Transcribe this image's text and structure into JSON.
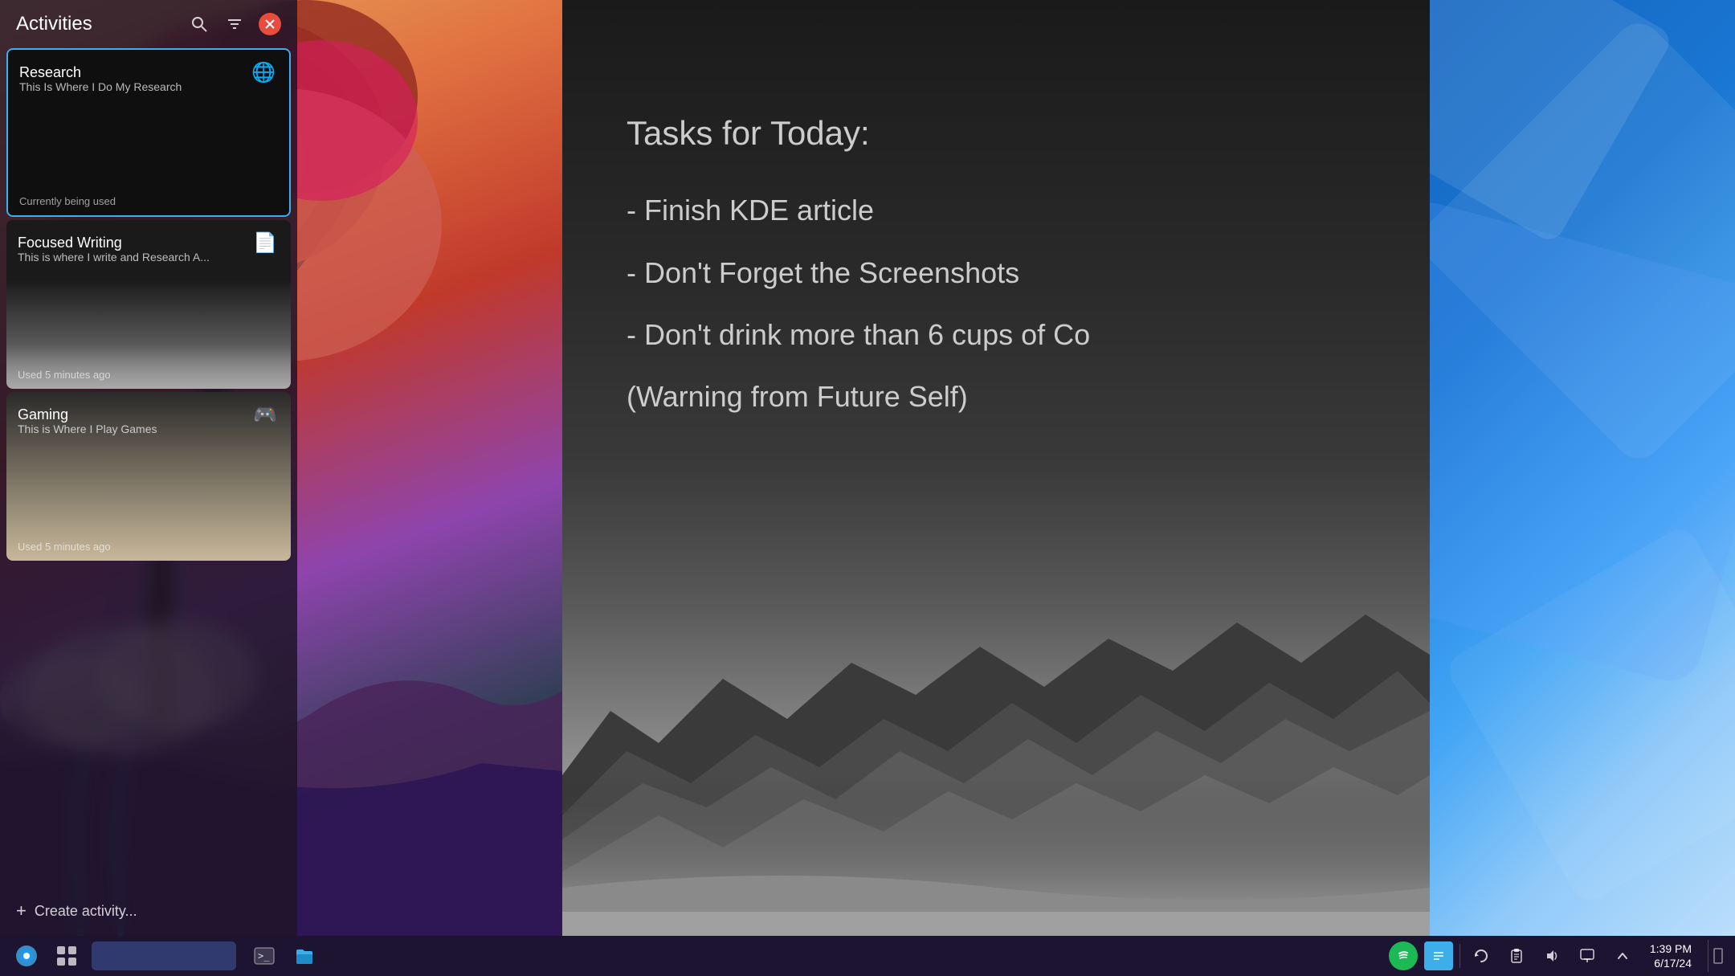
{
  "activities_panel": {
    "title": "Activities",
    "activities": [
      {
        "id": "research",
        "name": "Research",
        "description": "This Is Where I Do My Research",
        "status": "Currently being used",
        "icon": "🌐",
        "active": true
      },
      {
        "id": "focused-writing",
        "name": "Focused Writing",
        "description": "This is where I write and Research A...",
        "status": "Used 5 minutes ago",
        "icon": "📄",
        "active": false
      },
      {
        "id": "gaming",
        "name": "Gaming",
        "description": "This is Where I Play Games",
        "status": "Used 5 minutes ago",
        "icon": "🎮",
        "active": false
      }
    ],
    "create_label": "Create activity..."
  },
  "main_content": {
    "tasks_title": "Tasks for Today:",
    "tasks": [
      "- Finish KDE article",
      "- Don't Forget the Screenshots",
      "- Don't drink more than 6 cups of Co",
      "(Warning from Future Self)"
    ]
  },
  "taskbar": {
    "clock_time": "1:39 PM",
    "clock_date": "6/17/24",
    "apps": [
      {
        "name": "kde-launcher",
        "icon": "✦"
      },
      {
        "name": "activities-switcher",
        "icon": "⊞"
      },
      {
        "name": "terminal",
        "icon": ">"
      },
      {
        "name": "file-manager",
        "icon": "📁"
      }
    ],
    "tray_icons": [
      {
        "name": "refresh",
        "icon": "↺"
      },
      {
        "name": "clipboard",
        "icon": "📋"
      },
      {
        "name": "volume",
        "icon": "🔊"
      },
      {
        "name": "network",
        "icon": "🖥"
      },
      {
        "name": "chevron-up",
        "icon": "^"
      }
    ],
    "spotify_label": "Spotify",
    "notes_label": "Notes"
  }
}
